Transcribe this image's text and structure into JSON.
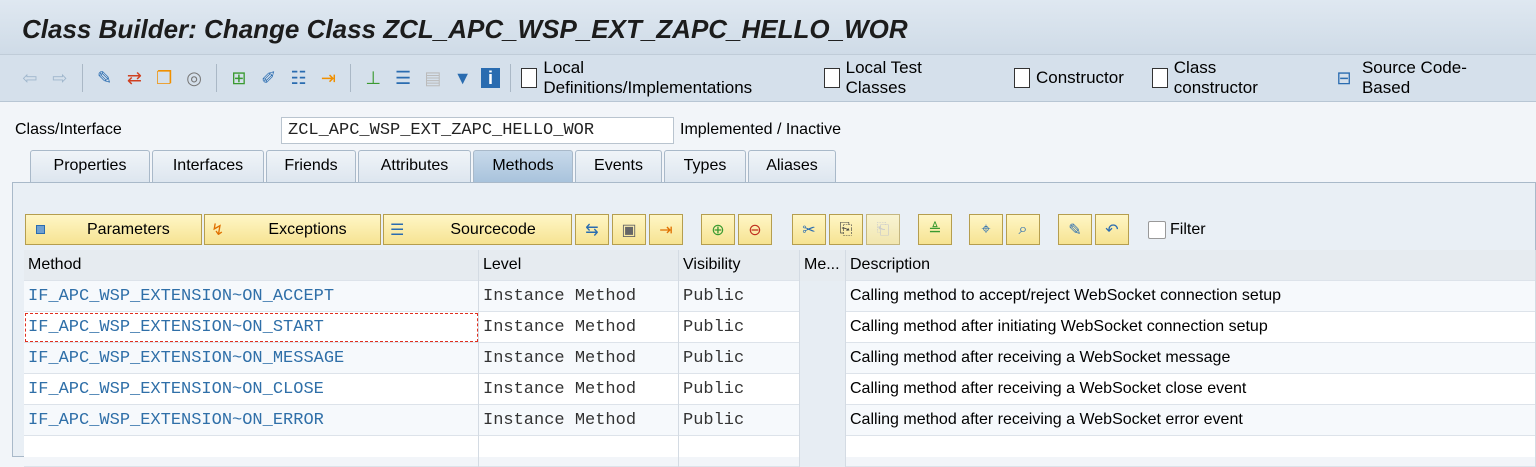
{
  "title": "Class Builder: Change Class ZCL_APC_WSP_EXT_ZAPC_HELLO_WOR",
  "toolbar": {
    "local_defs": "Local Definitions/Implementations",
    "local_tests": "Local Test Classes",
    "constructor": "Constructor",
    "class_constructor": "Class constructor",
    "source_code": "Source Code-Based"
  },
  "header": {
    "label": "Class/Interface",
    "value": "ZCL_APC_WSP_EXT_ZAPC_HELLO_WOR",
    "status": "Implemented / Inactive"
  },
  "tabs": [
    "Properties",
    "Interfaces",
    "Friends",
    "Attributes",
    "Methods",
    "Events",
    "Types",
    "Aliases"
  ],
  "active_tab": "Methods",
  "method_toolbar": {
    "parameters": "Parameters",
    "exceptions": "Exceptions",
    "sourcecode": "Sourcecode",
    "filter": "Filter"
  },
  "columns": [
    "Method",
    "Level",
    "Visibility",
    "Me...",
    "Description"
  ],
  "rows": [
    {
      "method": "IF_APC_WSP_EXTENSION~ON_ACCEPT",
      "level": "Instance Method",
      "visibility": "Public",
      "description": "Calling method to accept/reject WebSocket connection setup"
    },
    {
      "method": "IF_APC_WSP_EXTENSION~ON_START",
      "level": "Instance Method",
      "visibility": "Public",
      "description": "Calling method after initiating WebSocket connection setup"
    },
    {
      "method": "IF_APC_WSP_EXTENSION~ON_MESSAGE",
      "level": "Instance Method",
      "visibility": "Public",
      "description": "Calling method after receiving a WebSocket message"
    },
    {
      "method": "IF_APC_WSP_EXTENSION~ON_CLOSE",
      "level": "Instance Method",
      "visibility": "Public",
      "description": "Calling method after receiving a WebSocket close event"
    },
    {
      "method": "IF_APC_WSP_EXTENSION~ON_ERROR",
      "level": "Instance Method",
      "visibility": "Public",
      "description": "Calling method after receiving a WebSocket error event"
    }
  ]
}
